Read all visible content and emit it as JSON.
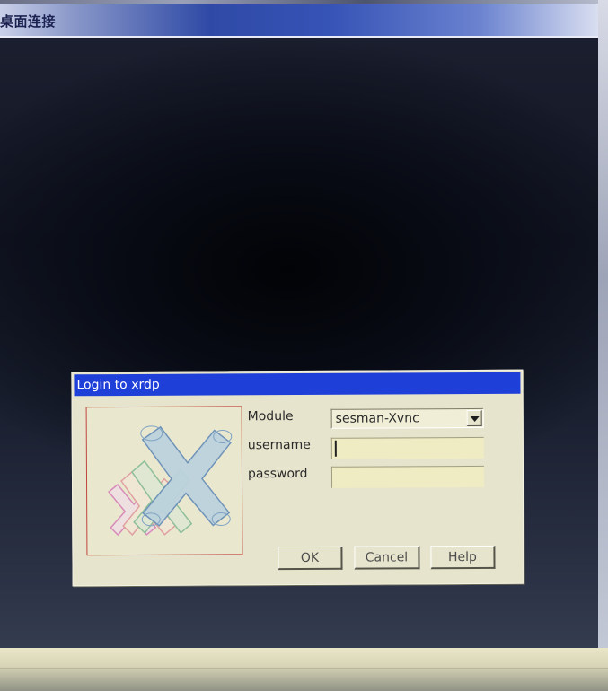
{
  "outer_window": {
    "title": "桌面连接"
  },
  "dialog": {
    "title": "Login to xrdp",
    "logo_icon": "xrdp-x-logo-icon",
    "fields": {
      "module_label": "Module",
      "module_value": "sesman-Xvnc",
      "username_label": "username",
      "username_value": "",
      "password_label": "password",
      "password_value": ""
    },
    "buttons": {
      "ok": "OK",
      "cancel": "Cancel",
      "help": "Help"
    }
  },
  "colors": {
    "dialog_background": "#e6e4cc",
    "titlebar_blue": "#1f3fd9",
    "input_background": "#efebc2",
    "logo_border": "#c0443e"
  }
}
